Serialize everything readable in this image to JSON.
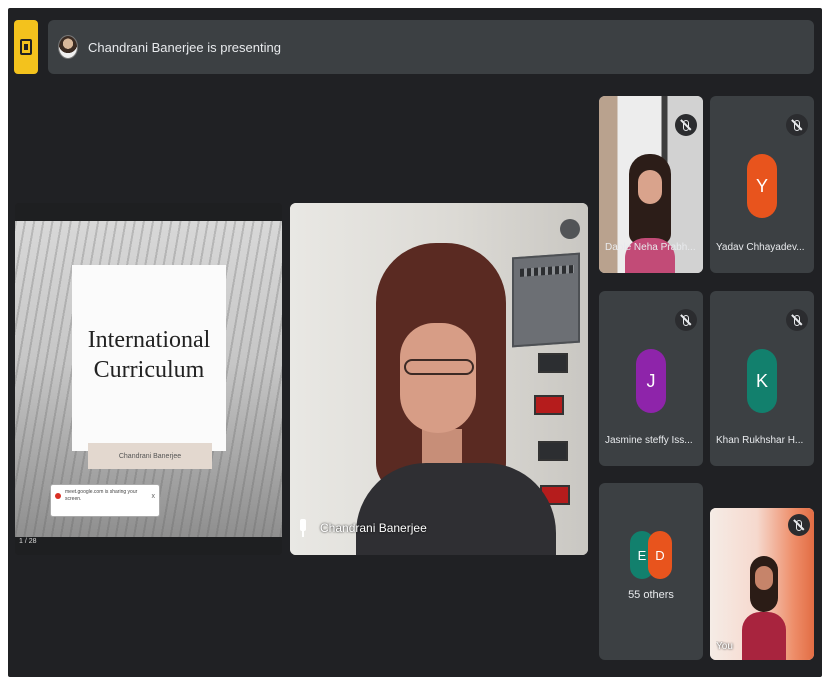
{
  "presenting_bar": {
    "text": "Chandrani Banerjee is presenting"
  },
  "shared_screen": {
    "slide_title": "International Curriculum",
    "slide_author": "Chandrani Banerjee",
    "toast_text": "meet.google.com is sharing your screen.",
    "toast_close": "x",
    "page_indicator": "1 / 28"
  },
  "presenter": {
    "name": "Chandrani Banerjee"
  },
  "participants": [
    {
      "name": "Dable Neha Prabh...",
      "type": "video"
    },
    {
      "name": "Yadav Chhayadev...",
      "initial": "Y",
      "color": "#e8541d"
    },
    {
      "name": "Jasmine steffy Iss...",
      "initial": "J",
      "color": "#8e24aa"
    },
    {
      "name": "Khan Rukhshar H...",
      "initial": "K",
      "color": "#12806d"
    }
  ],
  "others": {
    "avatars": [
      {
        "initial": "E",
        "color": "#12806d"
      },
      {
        "initial": "D",
        "color": "#e8541d"
      }
    ],
    "label": "55 others"
  },
  "self_tile": {
    "name": "You"
  },
  "theme": {
    "background": "#202124",
    "tile": "#3c4043",
    "logo": "#f3c21d"
  }
}
